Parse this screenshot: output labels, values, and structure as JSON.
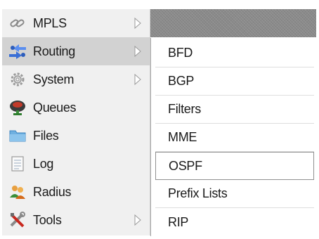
{
  "main_menu": {
    "items": [
      {
        "label": "MPLS",
        "icon": "mpls-icon",
        "has_submenu": true
      },
      {
        "label": "Routing",
        "icon": "routing-icon",
        "has_submenu": true,
        "selected": true
      },
      {
        "label": "System",
        "icon": "system-gear-icon",
        "has_submenu": true
      },
      {
        "label": "Queues",
        "icon": "queues-icon",
        "has_submenu": false
      },
      {
        "label": "Files",
        "icon": "folder-icon",
        "has_submenu": false
      },
      {
        "label": "Log",
        "icon": "log-icon",
        "has_submenu": false
      },
      {
        "label": "Radius",
        "icon": "radius-users-icon",
        "has_submenu": false
      },
      {
        "label": "Tools",
        "icon": "tools-icon",
        "has_submenu": true
      }
    ]
  },
  "routing_submenu": {
    "items": [
      {
        "label": "BFD"
      },
      {
        "label": "BGP"
      },
      {
        "label": "Filters"
      },
      {
        "label": "MME"
      },
      {
        "label": "OSPF",
        "focused": true
      },
      {
        "label": "Prefix Lists"
      },
      {
        "label": "RIP"
      }
    ]
  },
  "colors": {
    "menu_background": "#f0f0f0",
    "selected_background": "#d2d2d2",
    "header_strip": "#8a8a8a",
    "text": "#1a1a1a"
  }
}
